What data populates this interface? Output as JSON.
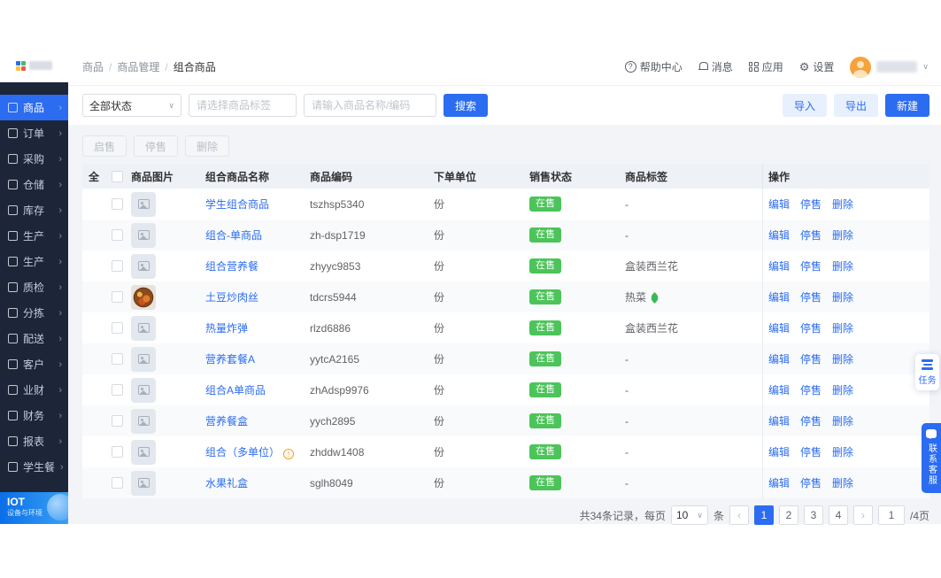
{
  "colors": {
    "primary": "#2b6cf0",
    "sidebar_bg": "#1c2638",
    "status_green": "#4cc45a",
    "logo_squares": [
      "#2b6cf0",
      "#3bbf6e",
      "#f5c53a",
      "#e85a4f"
    ]
  },
  "icons": {
    "help": "?",
    "settings_gear": "⚙",
    "chevron_down": "∨",
    "chevron_right": "›",
    "prev": "‹",
    "next": "›",
    "warning": "!",
    "select_caret": "∨"
  },
  "sidebar": {
    "items": [
      {
        "label": "商品",
        "icon": "goods-icon",
        "active": true
      },
      {
        "label": "订单",
        "icon": "order-icon"
      },
      {
        "label": "采购",
        "icon": "purchase-icon"
      },
      {
        "label": "仓储",
        "icon": "warehouse-icon"
      },
      {
        "label": "库存",
        "icon": "inventory-icon"
      },
      {
        "label": "生产",
        "icon": "production-icon"
      },
      {
        "label": "生产",
        "icon": "production-icon"
      },
      {
        "label": "质检",
        "icon": "quality-icon"
      },
      {
        "label": "分拣",
        "icon": "sorting-icon"
      },
      {
        "label": "配送",
        "icon": "delivery-icon"
      },
      {
        "label": "客户",
        "icon": "customer-icon"
      },
      {
        "label": "业财",
        "icon": "business-finance-icon"
      },
      {
        "label": "财务",
        "icon": "finance-icon"
      },
      {
        "label": "报表",
        "icon": "report-icon"
      },
      {
        "label": "学生餐",
        "icon": "student-meal-icon"
      }
    ],
    "iot_title": "IOT",
    "iot_subtitle": "设备与环境"
  },
  "topbar": {
    "breadcrumb": [
      "商品",
      "商品管理",
      "组合商品"
    ],
    "help_label": "帮助中心",
    "message_label": "消息",
    "app_label": "应用",
    "settings_label": "设置"
  },
  "filterbar": {
    "status_value": "全部状态",
    "tag_placeholder": "请选择商品标签",
    "keyword_placeholder": "请输入商品名称/编码",
    "search_label": "搜索",
    "import_label": "导入",
    "export_label": "导出",
    "create_label": "新建"
  },
  "bulk_actions": {
    "on_sale": "启售",
    "off_sale": "停售",
    "delete": "删除"
  },
  "table": {
    "index_header": "全",
    "columns": [
      "商品图片",
      "组合商品名称",
      "商品编码",
      "下单单位",
      "销售状态",
      "商品标签",
      "操作"
    ],
    "row_actions": [
      "编辑",
      "停售",
      "删除"
    ],
    "rows": [
      {
        "name": "学生组合商品",
        "code": "tszhsp5340",
        "unit": "份",
        "status": "在售",
        "tag": "-"
      },
      {
        "name": "组合-单商品",
        "code": "zh-dsp1719",
        "unit": "份",
        "status": "在售",
        "tag": "-"
      },
      {
        "name": "组合营养餐",
        "code": "zhyyc9853",
        "unit": "份",
        "status": "在售",
        "tag": "盒装西兰花"
      },
      {
        "name": "土豆炒肉丝",
        "code": "tdcrs5944",
        "unit": "份",
        "status": "在售",
        "tag": "热菜",
        "tag_icon": "broccoli-icon",
        "image": "food"
      },
      {
        "name": "热量炸弹",
        "code": "rlzd6886",
        "unit": "份",
        "status": "在售",
        "tag": "盒装西兰花"
      },
      {
        "name": "营养套餐A",
        "code": "yytcA2165",
        "unit": "份",
        "status": "在售",
        "tag": "-"
      },
      {
        "name": "组合A单商品",
        "code": "zhAdsp9976",
        "unit": "份",
        "status": "在售",
        "tag": "-"
      },
      {
        "name": "营养餐盒",
        "code": "yych2895",
        "unit": "份",
        "status": "在售",
        "tag": "-"
      },
      {
        "name": "组合（多单位）",
        "code": "zhddw1408",
        "unit": "份",
        "status": "在售",
        "tag": "-",
        "name_icon": "warning-icon"
      },
      {
        "name": "水果礼盒",
        "code": "sglh8049",
        "unit": "份",
        "status": "在售",
        "tag": "-"
      }
    ]
  },
  "pagination": {
    "total_prefix": "共34条记录，每页",
    "page_size": "10",
    "suffix": "条",
    "pages": [
      "1",
      "2",
      "3",
      "4"
    ],
    "active_page": "1",
    "jump_value": "1",
    "total_pages_label": "/4页"
  },
  "floating": {
    "task_label": "任务",
    "service_label": "联系客服"
  }
}
